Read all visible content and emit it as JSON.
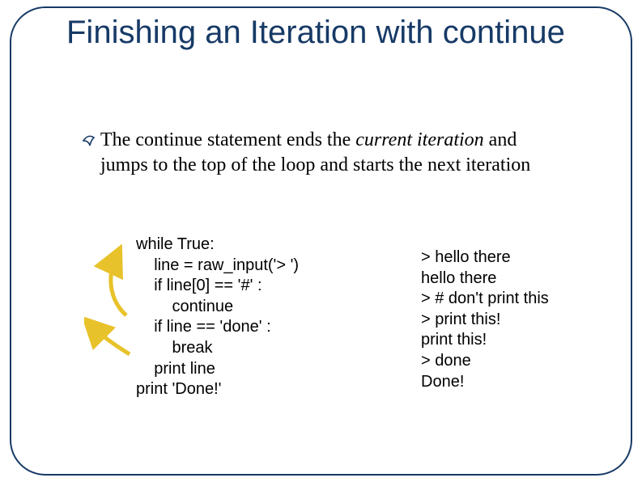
{
  "title": "Finishing an Iteration with continue",
  "bullet": {
    "pre": "The continue statement ends the ",
    "italic": "current iteration",
    "post": " and jumps to the top of the loop and starts the next iteration"
  },
  "code": "while True:\n    line = raw_input('> ')\n    if line[0] == '#' :\n        continue\n    if line == 'done' :\n        break\n    print line\nprint 'Done!'",
  "output": "> hello there\nhello there\n> # don't print this\n> print this!\nprint this!\n> done\nDone!"
}
